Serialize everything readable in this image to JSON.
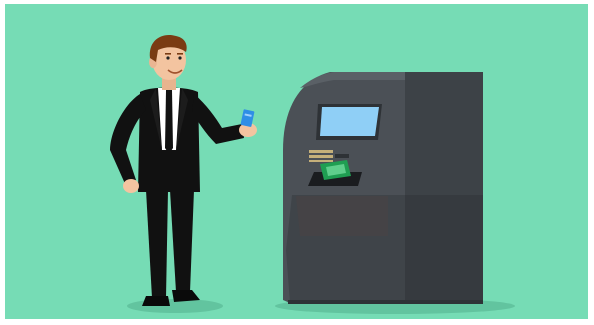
{
  "scene": {
    "background_color": "#76dcb5",
    "frame_color": "#ffffff",
    "shadow_color": "#62c49f"
  },
  "businessman": {
    "suit_color": "#111111",
    "shirt_color": "#ffffff",
    "tie_color": "#111111",
    "skin_color": "#f3c4a0",
    "hair_color": "#7a3b12",
    "card_color": "#2f8ee6"
  },
  "atm": {
    "body_color": "#4b5056",
    "side_color": "#3d4247",
    "dark_color": "#2e3236",
    "screen_color": "#8fcff6",
    "keypad_color": "#c5b07a",
    "cash_color": "#1f9e52",
    "slot_color": "#1a1c1f"
  }
}
